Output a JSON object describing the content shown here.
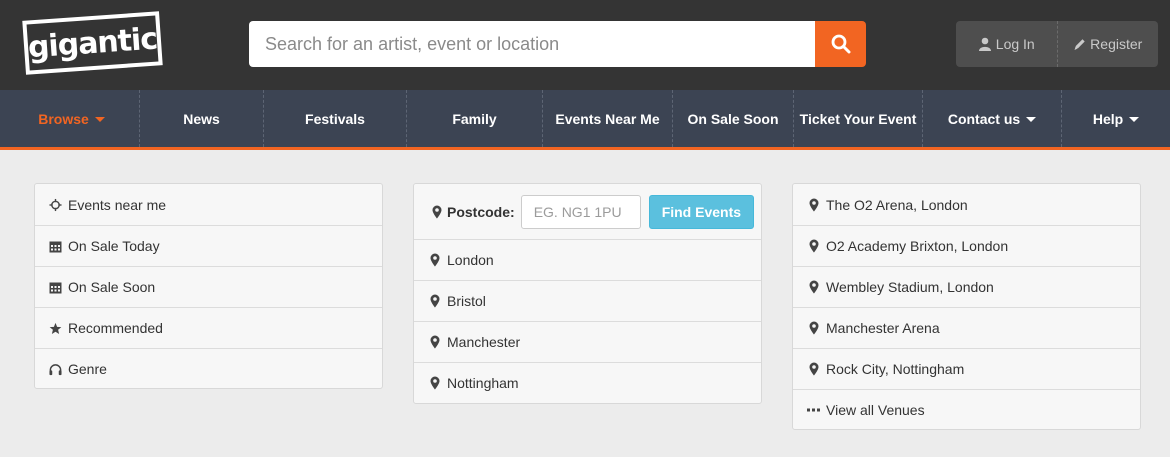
{
  "brand": {
    "logo_text": "gigantic"
  },
  "search": {
    "placeholder": "Search for an artist, event or location",
    "value": ""
  },
  "auth": {
    "login_label": "Log In",
    "register_label": "Register"
  },
  "nav": {
    "items": [
      {
        "label": "Browse"
      },
      {
        "label": "News"
      },
      {
        "label": "Festivals"
      },
      {
        "label": "Family"
      },
      {
        "label": "Events Near Me"
      },
      {
        "label": "On Sale Soon"
      },
      {
        "label": "Ticket Your Event"
      },
      {
        "label": "Contact us"
      },
      {
        "label": "Help"
      }
    ]
  },
  "browse_menu": {
    "items": [
      {
        "label": "Events near me",
        "icon": "crosshairs-icon"
      },
      {
        "label": "On Sale Today",
        "icon": "calendar-icon"
      },
      {
        "label": "On Sale Soon",
        "icon": "calendar-icon"
      },
      {
        "label": "Recommended",
        "icon": "star-icon"
      },
      {
        "label": "Genre",
        "icon": "headphones-icon"
      }
    ]
  },
  "locations": {
    "postcode_label": "Postcode:",
    "postcode_placeholder": "EG. NG1 1PU",
    "find_button": "Find Events",
    "cities": [
      {
        "label": "London"
      },
      {
        "label": "Bristol"
      },
      {
        "label": "Manchester"
      },
      {
        "label": "Nottingham"
      }
    ]
  },
  "venues": {
    "items": [
      {
        "label": "The O2 Arena, London"
      },
      {
        "label": "O2 Academy Brixton, London"
      },
      {
        "label": "Wembley Stadium, London"
      },
      {
        "label": "Manchester Arena"
      },
      {
        "label": "Rock City, Nottingham"
      }
    ],
    "view_all": "View all Venues"
  },
  "colors": {
    "accent": "#f26522",
    "header_bg": "#343434",
    "nav_bg": "#3c4453",
    "info_button": "#5bc0de"
  }
}
